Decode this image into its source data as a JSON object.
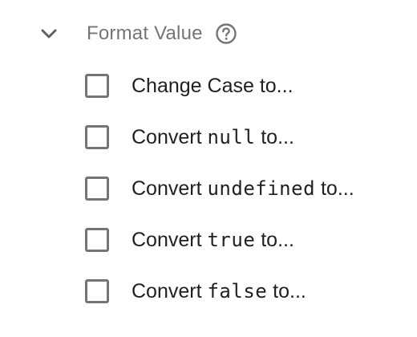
{
  "section": {
    "title": "Format Value",
    "expand_icon": "chevron-down-icon",
    "help_icon": "help-circle-icon"
  },
  "options": [
    {
      "prefix": "Change Case to...",
      "code": "",
      "suffix": ""
    },
    {
      "prefix": "Convert ",
      "code": "null",
      "suffix": " to..."
    },
    {
      "prefix": "Convert ",
      "code": "undefined",
      "suffix": " to..."
    },
    {
      "prefix": "Convert ",
      "code": "true",
      "suffix": " to..."
    },
    {
      "prefix": "Convert ",
      "code": "false",
      "suffix": " to..."
    }
  ],
  "colors": {
    "title": "#757575",
    "checkbox_border": "#757575",
    "label": "#212121"
  }
}
